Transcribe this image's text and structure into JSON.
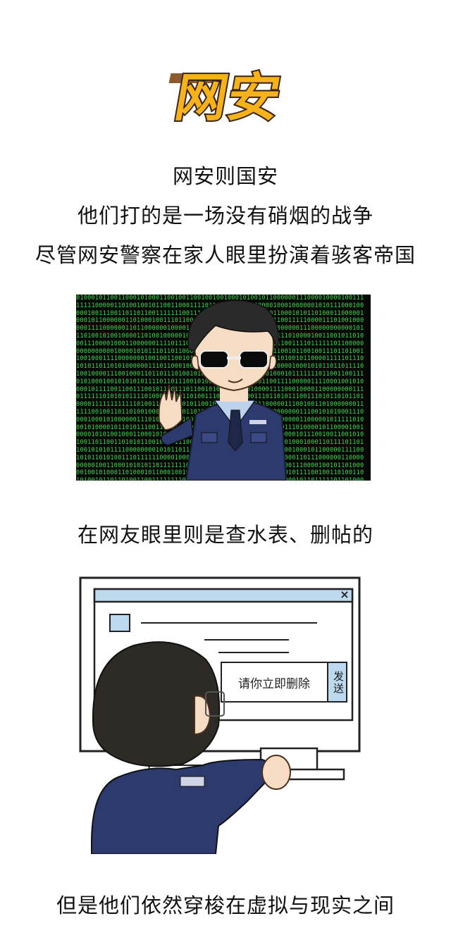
{
  "title": "网安",
  "intro_lines": [
    "网安则国安",
    "他们打的是一场没有硝烟的战争",
    "尽管网安警察在家人眼里扮演着骇客帝国"
  ],
  "caption_1": "在网友眼里则是查水表、删帖的",
  "dialog": {
    "message": "请你立即删除",
    "send_button": "发送",
    "close_symbol": "×"
  },
  "caption_2": "但是他们依然穿梭在虚拟与现实之间",
  "colors": {
    "title_fill": "#f6b21a",
    "title_outline": "#3a2416",
    "matrix_green": "#39d94a",
    "uniform": "#2d3a6e",
    "window_bar": "#bcd9ee"
  }
}
